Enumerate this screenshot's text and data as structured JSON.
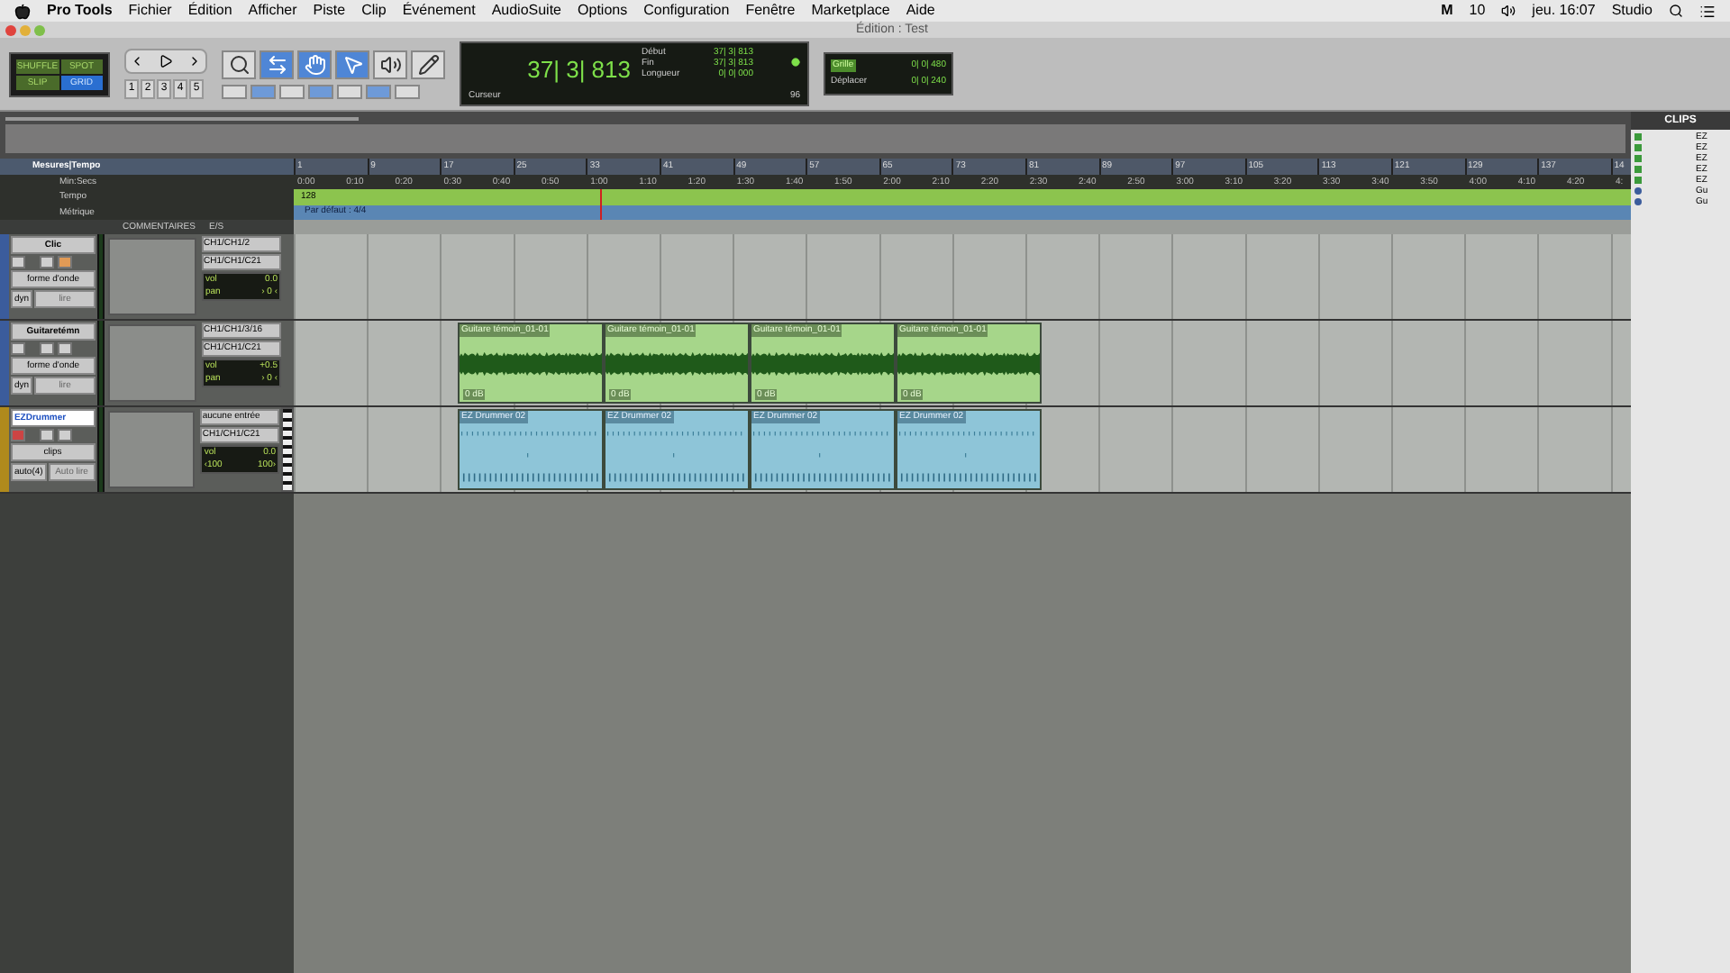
{
  "menu_bar": {
    "app": "Pro Tools",
    "items": [
      "Fichier",
      "Édition",
      "Afficher",
      "Piste",
      "Clip",
      "Événement",
      "AudioSuite",
      "Options",
      "Configuration",
      "Fenêtre",
      "Marketplace",
      "Aide"
    ],
    "status": [
      "M",
      "10",
      "jeu. 16:07",
      "Studio"
    ]
  },
  "window": {
    "title": "Édition : Test"
  },
  "toolbar": {
    "modes": [
      {
        "label": "SHUFFLE",
        "selected": false
      },
      {
        "label": "SPOT",
        "selected": false
      },
      {
        "label": "SLIP",
        "selected": false
      },
      {
        "label": "GRID",
        "selected": true
      }
    ],
    "zoom_presets": [
      "1",
      "2",
      "3",
      "4",
      "5"
    ],
    "tools": [
      {
        "kind": "zoom",
        "selected": false
      },
      {
        "kind": "trim",
        "selected": true
      },
      {
        "kind": "grab",
        "selected": true
      },
      {
        "kind": "smart",
        "selected": true
      },
      {
        "kind": "scrub",
        "selected": false
      },
      {
        "kind": "pencil",
        "selected": false
      }
    ],
    "counter": {
      "main": "37| 3| 813",
      "label": "Curseur",
      "fields": [
        {
          "label": "Début",
          "value": "37| 3| 813"
        },
        {
          "label": "Fin",
          "value": "37| 3| 813"
        },
        {
          "label": "Longueur",
          "value": "0| 0| 000"
        }
      ],
      "tempo": "96"
    },
    "grid": {
      "label": "Grille",
      "value": "0| 0| 480"
    },
    "nudge": {
      "label": "Déplacer",
      "value": "0| 0| 240"
    }
  },
  "rulers": {
    "labels": [
      "Mesures|Tempo",
      "Min:Secs",
      "Tempo",
      "Métrique"
    ],
    "bars": [
      "1",
      "9",
      "17",
      "25",
      "33",
      "41",
      "49",
      "57",
      "65",
      "73",
      "81",
      "89",
      "97",
      "105",
      "113",
      "121",
      "129",
      "137",
      "14"
    ],
    "minsecs": [
      "0:00",
      "0:10",
      "0:20",
      "0:30",
      "0:40",
      "0:50",
      "1:00",
      "1:10",
      "1:20",
      "1:30",
      "1:40",
      "1:50",
      "2:00",
      "2:10",
      "2:20",
      "2:30",
      "2:40",
      "2:50",
      "3:00",
      "3:10",
      "3:20",
      "3:30",
      "3:40",
      "3:50",
      "4:00",
      "4:10",
      "4:20",
      "4:"
    ],
    "tempo_marker": "128",
    "meter_marker": "Par défaut : 4/4"
  },
  "track_header": {
    "comments": "COMMENTAIRES",
    "io": "E/S"
  },
  "tracks": [
    {
      "name": "Clic",
      "kind": "audio",
      "selected": false,
      "color": "#3b5c9c",
      "view": "forme d'onde",
      "automation": "dyn",
      "mode": "lire",
      "input": "CH1/CH1/2",
      "output": "CH1/CH1/C21",
      "vol_label": "vol",
      "vol": "0.0",
      "pan_label": "pan",
      "pan": [
        "› 0 ‹"
      ]
    },
    {
      "name": "Guitaretémn",
      "kind": "audio",
      "selected": false,
      "color": "#3b5c9c",
      "view": "forme d'onde",
      "automation": "dyn",
      "mode": "lire",
      "input": "CH1/CH1/3/16",
      "output": "CH1/CH1/C21",
      "vol_label": "vol",
      "vol": "+0.5",
      "pan_label": "pan",
      "pan": [
        "› 0 ‹"
      ],
      "clips": [
        {
          "name": "Guitare témoin_01-01",
          "gain": "0 dB"
        },
        {
          "name": "Guitare témoin_01-01",
          "gain": "0 dB"
        },
        {
          "name": "Guitare témoin_01-01",
          "gain": "0 dB"
        },
        {
          "name": "Guitare témoin_01-01",
          "gain": "0 dB"
        }
      ]
    },
    {
      "name": "EZDrummer",
      "kind": "instrument",
      "selected": true,
      "color": "#b08a1c",
      "view": "clips",
      "automation": "auto(4)",
      "mode": "Auto lire",
      "input": "aucune entrée",
      "output": "CH1/CH1/C21",
      "vol_label": "vol",
      "vol": "0.0",
      "pan": [
        "‹100",
        "100›"
      ],
      "clips": [
        {
          "name": "EZ Drummer 02"
        },
        {
          "name": "EZ Drummer 02"
        },
        {
          "name": "EZ Drummer 02"
        },
        {
          "name": "EZ Drummer 02"
        }
      ]
    }
  ],
  "clips_panel": {
    "title": "CLIPS",
    "items": [
      {
        "name": "EZ",
        "kind": "audio"
      },
      {
        "name": "EZ",
        "kind": "audio"
      },
      {
        "name": "EZ",
        "kind": "audio"
      },
      {
        "name": "EZ",
        "kind": "audio"
      },
      {
        "name": "EZ",
        "kind": "audio"
      },
      {
        "name": "Gu",
        "kind": "midi"
      },
      {
        "name": "Gu",
        "kind": "midi"
      }
    ]
  }
}
